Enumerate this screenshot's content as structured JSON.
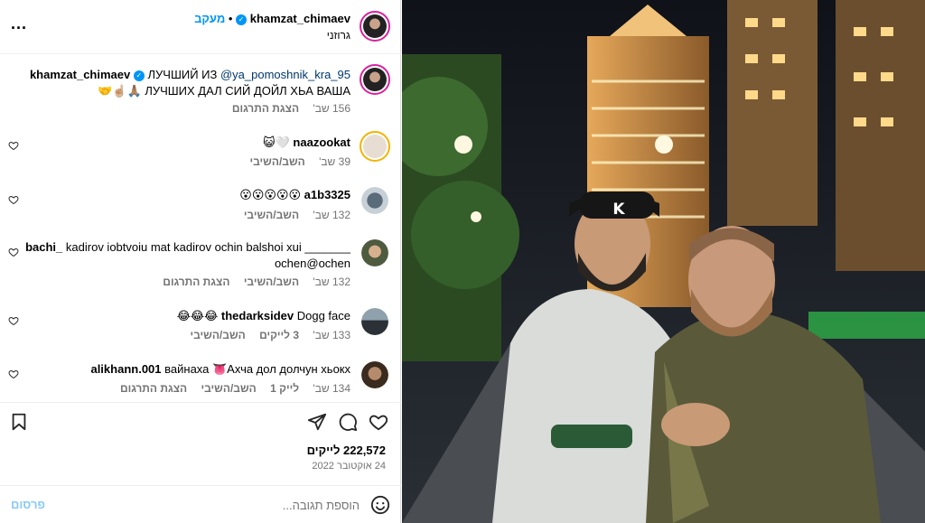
{
  "header": {
    "username": "khamzat_chimaev",
    "follow_label": "מעקב",
    "dot": "•",
    "subtitle": "גרוזני",
    "more_label": "..."
  },
  "caption": {
    "mention": "@ya_pomoshnik_kra_95",
    "username": "khamzat_chimaev",
    "line1": "ЛУЧШИЙ ИЗ",
    "line2": "ЛУЧШИХ ДАЛ СИЙ ДОЙЛ ХЬА ВАША 🙏🏽☝🏼🤝",
    "time": "156 שב'",
    "translate": "הצגת התרגום"
  },
  "comments": [
    {
      "username": "naazookat",
      "text": "🤍😺",
      "time": "39 שב'",
      "reply": "השב/השיבי",
      "likes": "",
      "translate": ""
    },
    {
      "username": "a1b3325",
      "text": "😮😮😮😮😮",
      "time": "132 שב'",
      "reply": "השב/השיבי",
      "likes": "",
      "translate": ""
    },
    {
      "username": "bachi_",
      "text": "kadirov iobtvoiu mat kadirov ochin balshoi xui _______ ochen@ochen",
      "time": "132 שב'",
      "reply": "השב/השיבי",
      "likes": "",
      "translate": "הצגת התרגום"
    },
    {
      "username": "thedarksidev",
      "text": "Dogg face 😂😂😂",
      "time": "133 שב'",
      "reply": "השב/השיבי",
      "likes": "3 לייקים",
      "translate": ""
    },
    {
      "username": "alikhann.001",
      "text": "вайнаха 👅Ахча дол долчун хьокх",
      "time": "134 שב'",
      "reply": "השב/השיבי",
      "likes": "לייק 1",
      "translate": "הצגת התרגום"
    }
  ],
  "post": {
    "likes": "222,572 לייקים",
    "date": "24 אוקטובר 2022"
  },
  "add_comment": {
    "placeholder": "הוספת תגובה...",
    "post_label": "פרסום"
  },
  "photo": {
    "cap_letter": "K"
  },
  "colors": {
    "accent": "#0095f6",
    "post_disabled": "#89c9f8",
    "meta": "#737373"
  }
}
